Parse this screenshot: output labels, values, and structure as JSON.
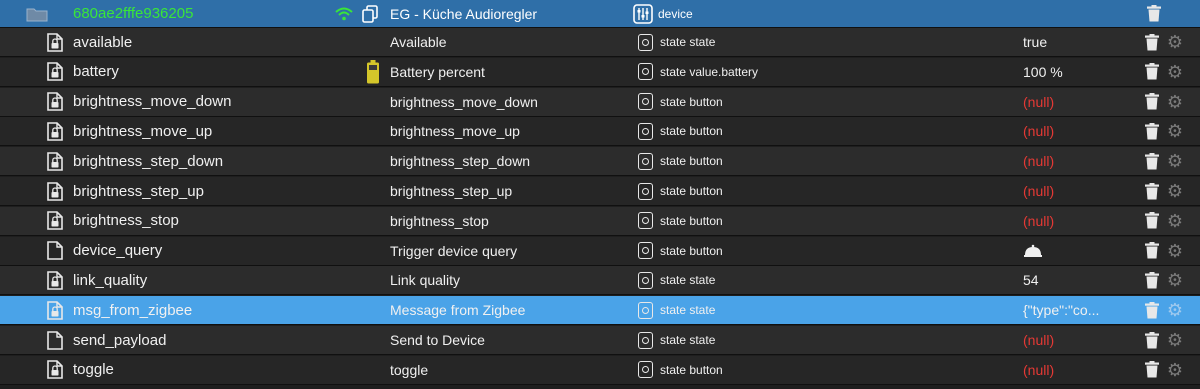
{
  "header": {
    "name": "680ae2fffe936205",
    "label": "EG - Küche Audioregler",
    "role": "device",
    "colors": {
      "background": "#2f6fa8",
      "name": "#39e639"
    }
  },
  "rows": [
    {
      "name": "available",
      "label": "Available",
      "role": "state state",
      "value": "true",
      "icon": "lock-file-icon"
    },
    {
      "name": "battery",
      "label": "Battery percent",
      "role": "state value.battery",
      "value": "100 %",
      "icon": "lock-file-icon",
      "device_icon": "battery-icon"
    },
    {
      "name": "brightness_move_down",
      "label": "brightness_move_down",
      "role": "state button",
      "value": "(null)",
      "icon": "lock-file-icon"
    },
    {
      "name": "brightness_move_up",
      "label": "brightness_move_up",
      "role": "state button",
      "value": "(null)",
      "icon": "lock-file-icon"
    },
    {
      "name": "brightness_step_down",
      "label": "brightness_step_down",
      "role": "state button",
      "value": "(null)",
      "icon": "lock-file-icon"
    },
    {
      "name": "brightness_step_up",
      "label": "brightness_step_up",
      "role": "state button",
      "value": "(null)",
      "icon": "lock-file-icon"
    },
    {
      "name": "brightness_stop",
      "label": "brightness_stop",
      "role": "state button",
      "value": "(null)",
      "icon": "lock-file-icon"
    },
    {
      "name": "device_query",
      "label": "Trigger device query",
      "role": "state button",
      "value": "",
      "value_icon": "bell-icon",
      "icon": "file-icon"
    },
    {
      "name": "link_quality",
      "label": "Link quality",
      "role": "state state",
      "value": "54",
      "icon": "lock-file-icon"
    },
    {
      "name": "msg_from_zigbee",
      "label": "Message from Zigbee",
      "role": "state state",
      "value": "{\"type\":\"co...",
      "icon": "lock-file-icon",
      "selected": true
    },
    {
      "name": "send_payload",
      "label": "Send to Device",
      "role": "state state",
      "value": "(null)",
      "icon": "file-icon"
    },
    {
      "name": "toggle",
      "label": "toggle",
      "role": "state button",
      "value": "(null)",
      "icon": "lock-file-icon"
    }
  ],
  "colors": {
    "null": "#e53935",
    "selected": "#4aa3e8",
    "row_bg": "#262626"
  }
}
